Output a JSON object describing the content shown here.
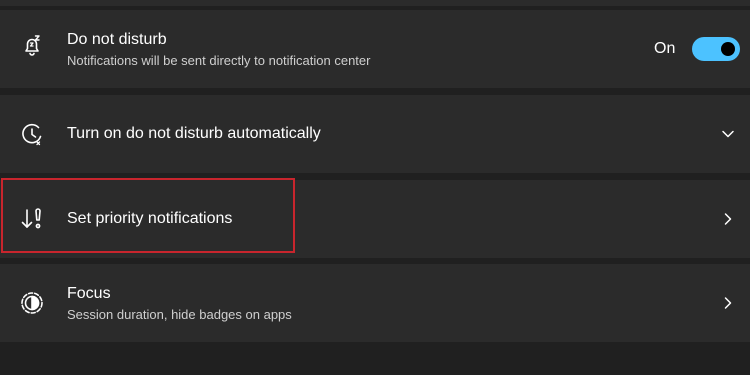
{
  "settings": [
    {
      "title": "Do not disturb",
      "subtitle": "Notifications will be sent directly to notification center",
      "icon": "bell-snooze-icon",
      "control": "toggle",
      "toggle_label": "On",
      "toggle_state": true
    },
    {
      "title": "Turn on do not disturb automatically",
      "icon": "clock-icon",
      "control": "chevron-down"
    },
    {
      "title": "Set priority notifications",
      "icon": "priority-arrow-icon",
      "control": "chevron-right",
      "highlighted": true
    },
    {
      "title": "Focus",
      "subtitle": "Session duration, hide badges on apps",
      "icon": "focus-icon",
      "control": "chevron-right"
    }
  ],
  "colors": {
    "background": "#202020",
    "card": "#2b2b2b",
    "accent": "#4cc2ff",
    "highlight_border": "#c8252d"
  }
}
